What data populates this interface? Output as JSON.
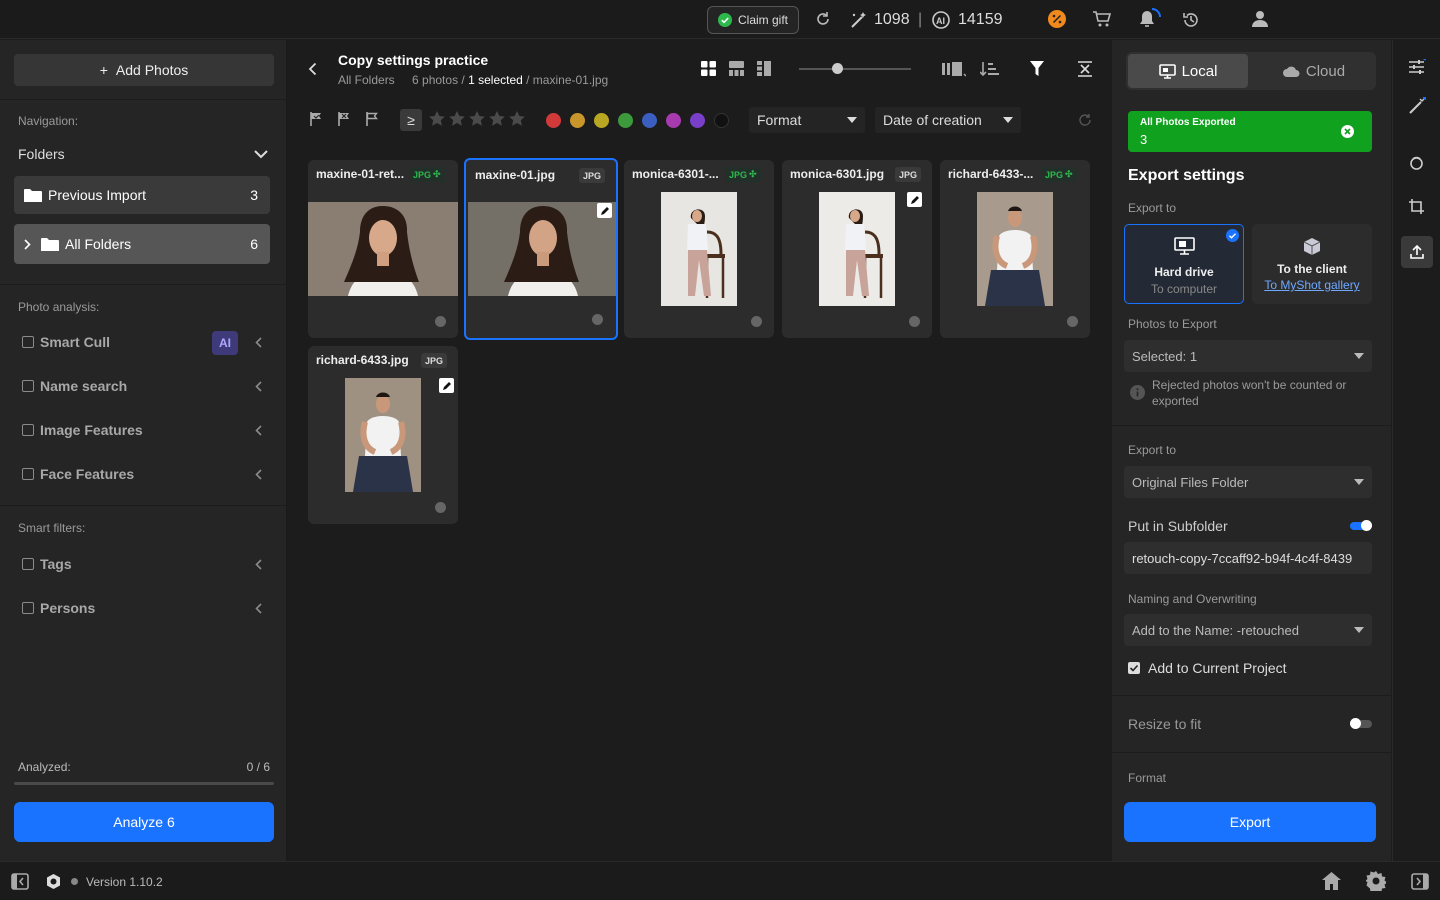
{
  "topbar": {
    "claim_gift": "Claim gift",
    "credits_edit": "1098",
    "separator": "|",
    "credits_ai": "14159"
  },
  "left": {
    "add_photos": "Add Photos",
    "navigation_label": "Navigation:",
    "folders_label": "Folders",
    "folders": [
      {
        "label": "Previous Import",
        "count": "3"
      },
      {
        "label": "All Folders",
        "count": "6"
      }
    ],
    "photo_analysis_label": "Photo analysis:",
    "analysis_items": [
      "Smart Cull",
      "Name search",
      "Image Features",
      "Face Features"
    ],
    "ai_badge": "AI",
    "smart_filters_label": "Smart filters:",
    "smart_filters": [
      "Tags",
      "Persons"
    ],
    "analyzed_label": "Analyzed:",
    "analyzed_value": "0 / 6",
    "analyzed_fraction": 0,
    "analyze_button": "Analyze 6"
  },
  "center": {
    "project_title": "Copy settings practice",
    "subtitle_folder": "All Folders",
    "subtitle_photos": "6 photos /",
    "subtitle_selected": "1 selected",
    "subtitle_file": "/ maxine-01.jpg",
    "ge_symbol": "≥",
    "color_labels": [
      "#d23a3a",
      "#c9962b",
      "#b9a623",
      "#3c9a3c",
      "#3b5fc0",
      "#a83ab0",
      "#7a3fc8",
      "#111111"
    ],
    "format_dropdown": "Format",
    "sort_dropdown": "Date of creation",
    "photos": [
      {
        "name": "maxine-01-ret...",
        "ext": "JPG",
        "ext_style": "green",
        "edited": false,
        "selected": false,
        "subject": "maxine-portrait"
      },
      {
        "name": "maxine-01.jpg",
        "ext": "JPG",
        "ext_style": "plain",
        "edited": true,
        "selected": true,
        "subject": "maxine-portrait"
      },
      {
        "name": "monica-6301-...",
        "ext": "JPG",
        "ext_style": "green",
        "edited": false,
        "selected": false,
        "subject": "monica-full-body"
      },
      {
        "name": "monica-6301.jpg",
        "ext": "JPG",
        "ext_style": "plain",
        "edited": true,
        "selected": false,
        "subject": "monica-full-body"
      },
      {
        "name": "richard-6433-...",
        "ext": "JPG",
        "ext_style": "green",
        "edited": false,
        "selected": false,
        "subject": "richard-seated"
      },
      {
        "name": "richard-6433.jpg",
        "ext": "JPG",
        "ext_style": "plain",
        "edited": true,
        "selected": false,
        "subject": "richard-seated"
      }
    ]
  },
  "right": {
    "local_tab": "Local",
    "cloud_tab": "Cloud",
    "toast_title": "All Photos Exported",
    "toast_count": "3",
    "export_settings": "Export settings",
    "export_to_label": "Export to",
    "hard_drive": "Hard drive",
    "to_computer": "To computer",
    "to_client": "To the client",
    "to_myshot": "To MyShot gallery",
    "photos_to_export_label": "Photos to Export",
    "photos_to_export_value": "Selected: 1",
    "rejected_note": "Rejected photos won't be counted or exported",
    "export_to_label2": "Export to",
    "export_folder": "Original Files Folder",
    "subfolder_label": "Put in Subfolder",
    "subfolder_on": true,
    "subfolder_value": "retouch-copy-7ccaff92-b94f-4c4f-8439",
    "naming_label": "Naming and Overwriting",
    "naming_value": "Add to the Name: -retouched",
    "add_to_project": "Add to Current Project",
    "add_to_project_checked": true,
    "resize_label": "Resize to fit",
    "resize_on": false,
    "format_label": "Format",
    "export_button": "Export"
  },
  "footer": {
    "version": "Version 1.10.2"
  },
  "colors": {
    "accent": "#1a73ff",
    "toast": "#10a11e",
    "badge_orange": "#f08a1c"
  }
}
